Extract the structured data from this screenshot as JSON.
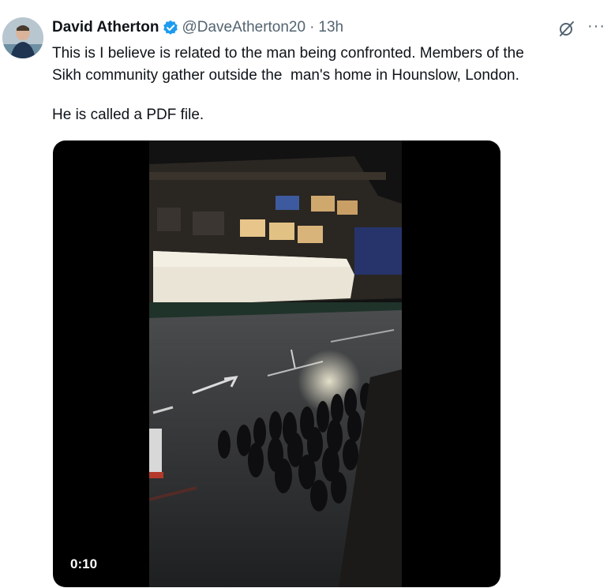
{
  "tweet": {
    "author_name": "David Atherton",
    "handle": "@DaveAtherton20",
    "separator": "·",
    "time": "13h",
    "text_line_1": "This is I believe is related to the man being confronted. Members of the",
    "text_line_2": "Sikh community gather outside the  man's home in Hounslow, London.",
    "text_line_3": "He is called a PDF file.",
    "verified_color": "#1d9bf0",
    "icons": [
      "verified-badge-icon",
      "grok-icon",
      "more-icon"
    ]
  },
  "video": {
    "duration_label": "0:10"
  }
}
